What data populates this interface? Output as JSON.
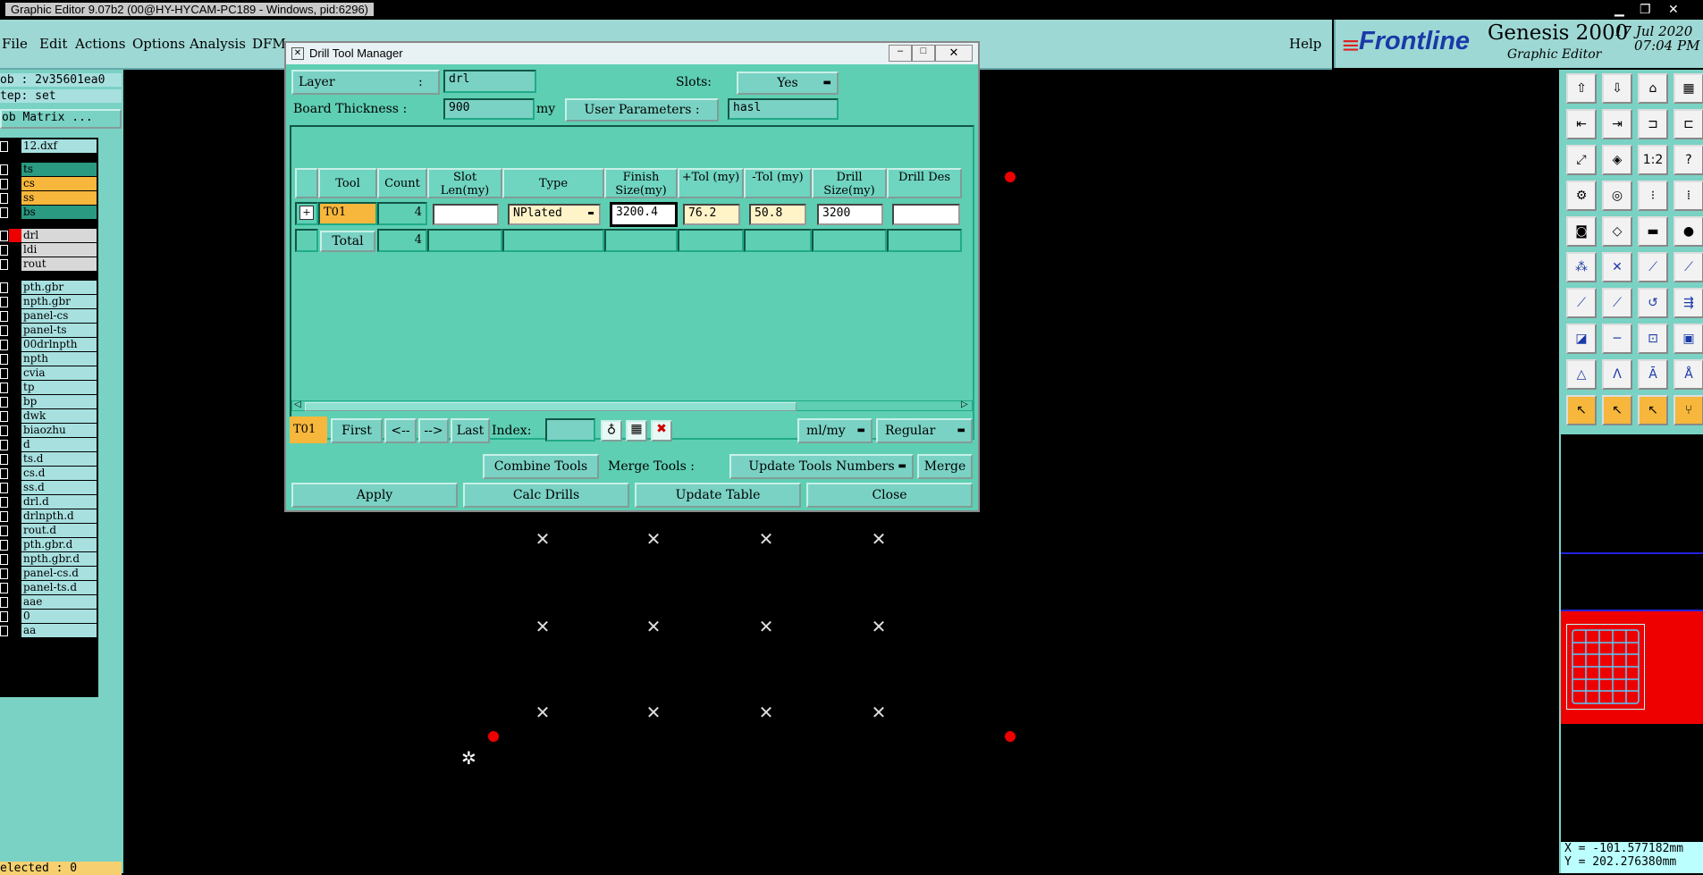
{
  "window_title": "Graphic Editor 9.07b2 (00@HY-HYCAM-PC189 - Windows, pid:6296)",
  "menu": [
    "File",
    "Edit",
    "Actions",
    "Options",
    "Analysis",
    "DFM"
  ],
  "menu_help": "Help",
  "brand": {
    "logo": "Frontline",
    "product": "Genesis 2000",
    "subtitle": "Graphic Editor",
    "date": "17 Jul 2020",
    "time": "07:04 PM"
  },
  "left": {
    "job": "ob : 2v35601ea0",
    "step": "tep: set",
    "job_matrix": "ob Matrix ...",
    "layers_top": [
      "12.dxf"
    ],
    "layers_signal": [
      "ts",
      "cs",
      "ss",
      "bs"
    ],
    "layers_drill": [
      "drl",
      "ldi",
      "rout"
    ],
    "layers_misc": [
      "pth.gbr",
      "npth.gbr",
      "panel-cs",
      "panel-ts",
      "00drlnpth",
      "npth",
      "cvia",
      "tp",
      "bp",
      "dwk",
      "biaozhu",
      "d",
      "ts.d",
      "cs.d",
      "ss.d",
      "drl.d",
      "drlnpth.d",
      "rout.d",
      "pth.gbr.d",
      "npth.gbr.d",
      "panel-cs.d",
      "panel-ts.d",
      "aae",
      "0",
      "aa"
    ],
    "selected": "elected : 0"
  },
  "dialog": {
    "title": "Drill Tool Manager",
    "layer_label": "Layer",
    "layer_colon": ":",
    "layer_value": "drl",
    "slots_label": "Slots:",
    "slots_value": "Yes",
    "thickness_label": "Board Thickness :",
    "thickness_value": "900",
    "thickness_unit": "my",
    "user_params_label": "User Parameters :",
    "user_params_value": "hasl",
    "columns": [
      "Tool",
      "Count",
      "Slot Len(my)",
      "Type",
      "Finish Size(my)",
      "+Tol (my)",
      "-Tol (my)",
      "Drill Size(my)",
      "Drill Des"
    ],
    "row": {
      "tool": "T01",
      "count": "4",
      "slot_len": "",
      "type": "NPlated",
      "finish": "3200.4",
      "ptol": "76.2",
      "ntol": "50.8",
      "drill": "3200",
      "des": ""
    },
    "total": {
      "label": "Total",
      "count": "4"
    },
    "nav": {
      "current": "T01",
      "first": "First",
      "prev": "<--",
      "next": "-->",
      "last": "Last",
      "index_label": "Index:",
      "units": "ml/my",
      "mode": "Regular"
    },
    "combine": "Combine Tools",
    "merge_label": "Merge Tools :",
    "merge_option": "Update Tools Numbers",
    "merge": "Merge",
    "apply": "Apply",
    "calc": "Calc Drills",
    "update": "Update Table",
    "close": "Close"
  },
  "coords": {
    "x": "X = -101.577182mm",
    "y": "Y = 202.276380mm"
  },
  "toolbar_icons": [
    "open-icon",
    "save-icon",
    "home-icon",
    "layout-icon",
    "import-icon",
    "export-icon",
    "step-icon",
    "window-icon",
    "zoom-fit-icon",
    "zoom-icon",
    "scale-icon",
    "help-icon",
    "properties-icon",
    "snap-icon",
    "measure-icon",
    "select-icon",
    "pad-icon",
    "shape-icon",
    "line-icon",
    "circle-icon",
    "node-icon",
    "cross-icon",
    "connect-icon",
    "move-icon",
    "draw-icon",
    "slash-icon",
    "arc-icon",
    "route-icon",
    "pin-icon",
    "segment-icon",
    "resize-icon",
    "group-icon",
    "triangle-icon",
    "a-icon",
    "a-bar-icon",
    "a-arc-icon",
    "pointer-icon",
    "pointer-red-icon",
    "pointer-alt-icon",
    "tree-icon"
  ]
}
